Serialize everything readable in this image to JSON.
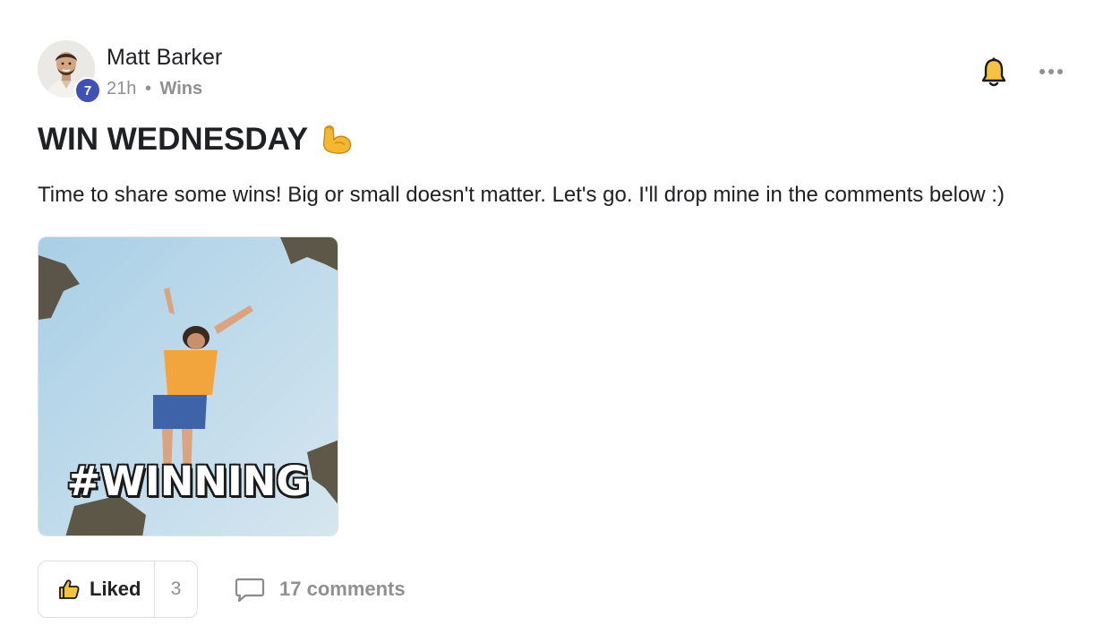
{
  "author": {
    "name": "Matt Barker",
    "level": "7"
  },
  "meta": {
    "time": "21h",
    "separator": "•",
    "category": "Wins"
  },
  "post": {
    "title": "WIN WEDNESDAY",
    "title_emoji": "flexed-biceps",
    "body": "Time to share some wins! Big or small doesn't matter. Let's go. I'll drop mine in the comments below :)",
    "gif_caption": "#WINNING"
  },
  "actions": {
    "like_label": "Liked",
    "like_count": "3",
    "comments_label": "17 comments"
  },
  "icons": {
    "notifications": "bell-icon",
    "more": "more-horizontal-icon",
    "like": "thumbs-up-icon",
    "comment": "comment-bubble-icon"
  },
  "colors": {
    "level_badge": "#3f51b5",
    "bell_fill": "#f5c243",
    "text_primary": "#202124",
    "text_muted": "#909090"
  }
}
